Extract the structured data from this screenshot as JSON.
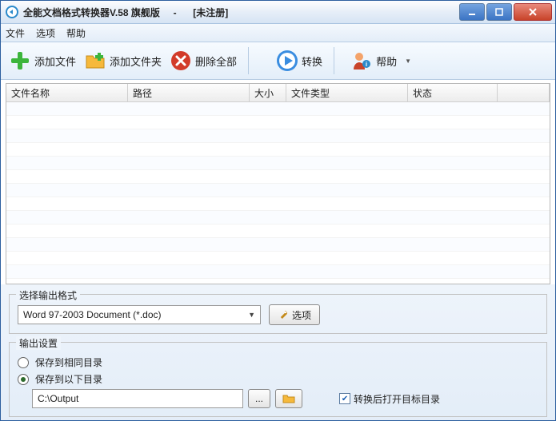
{
  "window": {
    "title": "全能文档格式转换器V.58 旗舰版     -     ",
    "status": "[未注册]"
  },
  "menu": {
    "file": "文件",
    "options": "选项",
    "help": "帮助"
  },
  "toolbar": {
    "add_file": "添加文件",
    "add_folder": "添加文件夹",
    "remove_all": "删除全部",
    "convert": "转换",
    "help": "帮助"
  },
  "table": {
    "cols": {
      "name": "文件名称",
      "path": "路径",
      "size": "大小",
      "type": "文件类型",
      "state": "状态"
    }
  },
  "format": {
    "legend": "选择输出格式",
    "selected": "Word 97-2003 Document (*.doc)",
    "options_btn": "选项"
  },
  "output": {
    "legend": "输出设置",
    "same_dir": "保存到相同目录",
    "below_dir": "保存到以下目录",
    "selected": "below",
    "path": "C:\\Output",
    "browse": "...",
    "open_after": "转换后打开目标目录",
    "open_after_checked": true
  }
}
